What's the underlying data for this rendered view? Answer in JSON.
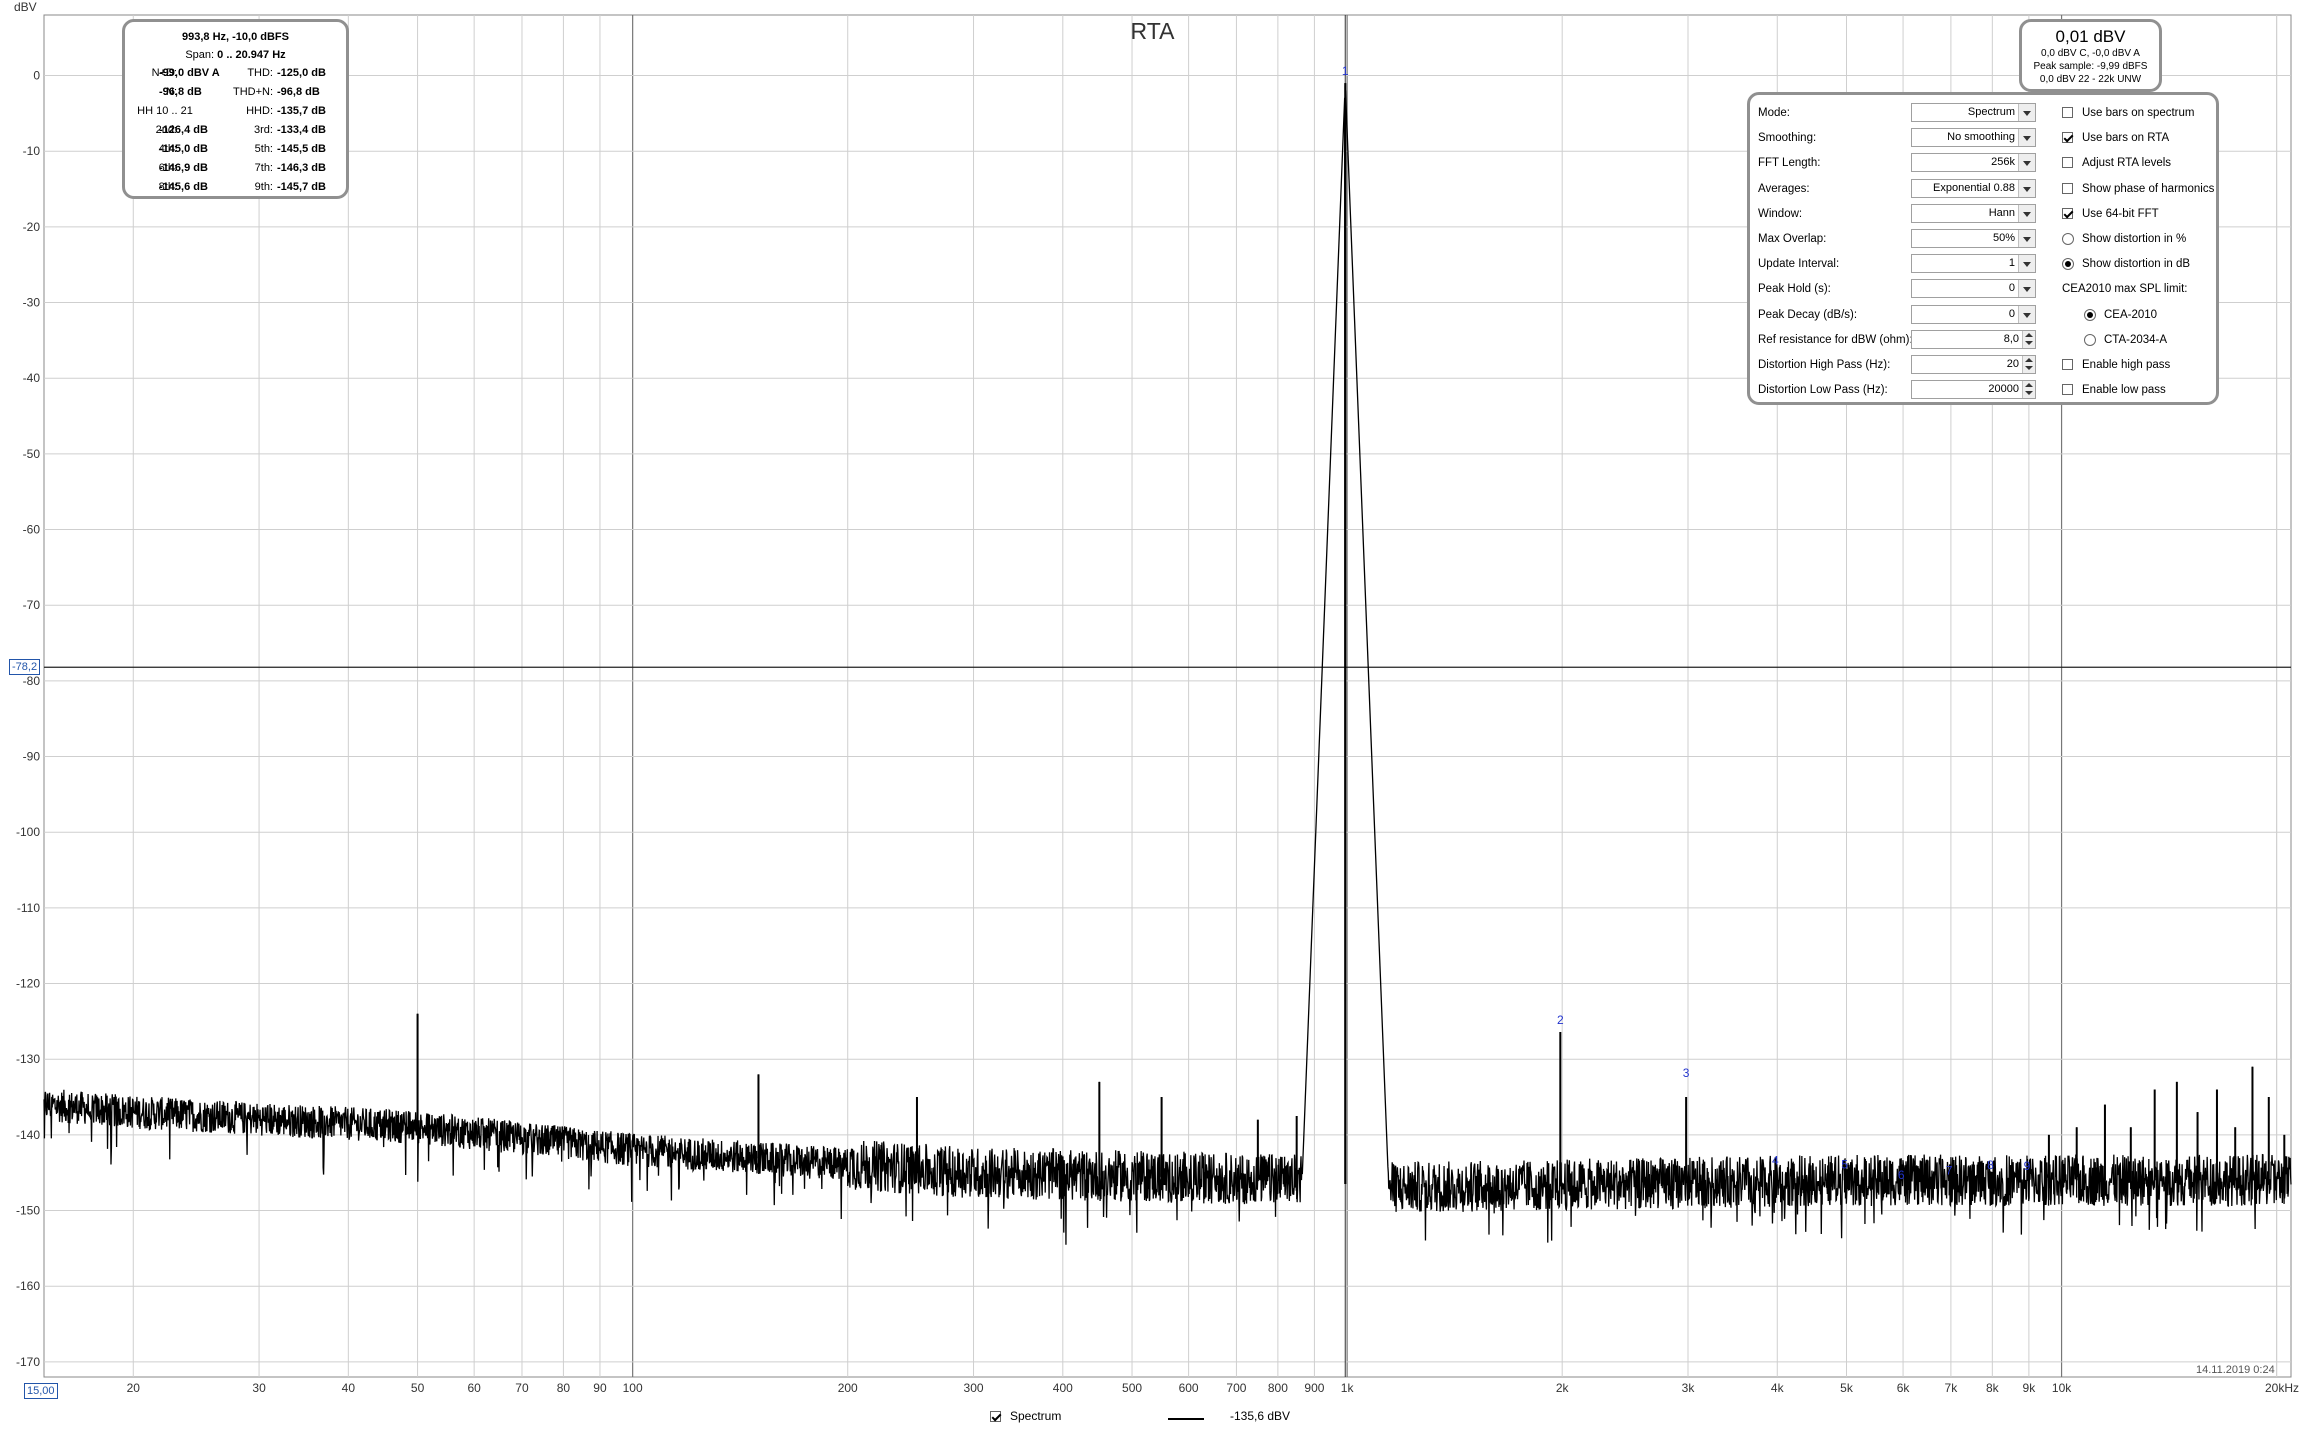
{
  "chart_data": {
    "type": "line",
    "title": "RTA",
    "xlabel": "",
    "ylabel": "dBV",
    "xscale": "log",
    "xlim": [
      15,
      20947
    ],
    "ylim": [
      -172,
      8
    ],
    "grid": true,
    "x_tick_labels": [
      "20",
      "30",
      "40",
      "50",
      "60",
      "70",
      "80",
      "90",
      "100",
      "200",
      "300",
      "400",
      "500",
      "600",
      "700",
      "800",
      "900",
      "1k",
      "2k",
      "3k",
      "4k",
      "5k",
      "6k",
      "7k",
      "8k",
      "9k",
      "10k",
      "20kHz"
    ],
    "x_tick_values": [
      20,
      30,
      40,
      50,
      60,
      70,
      80,
      90,
      100,
      200,
      300,
      400,
      500,
      600,
      700,
      800,
      900,
      1000,
      2000,
      3000,
      4000,
      5000,
      6000,
      7000,
      8000,
      9000,
      10000,
      20000
    ],
    "y_tick_values": [
      0,
      -10,
      -20,
      -30,
      -40,
      -50,
      -60,
      -70,
      -80,
      -90,
      -100,
      -110,
      -120,
      -130,
      -140,
      -150,
      -160,
      -170
    ],
    "series": [
      {
        "name": "Spectrum",
        "color": "#000000",
        "noise_floor": {
          "x": [
            15,
            20,
            50,
            100,
            300,
            900,
            1100,
            5000,
            10000,
            20947
          ],
          "y": [
            -136,
            -137,
            -139,
            -142,
            -145,
            -146,
            -147,
            -146,
            -146,
            -146
          ]
        },
        "peaks": [
          {
            "x": 50,
            "y": -124
          },
          {
            "x": 150,
            "y": -132
          },
          {
            "x": 250,
            "y": -135
          },
          {
            "x": 450,
            "y": -133
          },
          {
            "x": 550,
            "y": -135
          },
          {
            "x": 750,
            "y": -138
          },
          {
            "x": 850,
            "y": -137.5
          },
          {
            "x": 994,
            "y": -1
          },
          {
            "x": 1988,
            "y": -126.4
          },
          {
            "x": 2982,
            "y": -135
          },
          {
            "x": 3976,
            "y": -143
          },
          {
            "x": 4970,
            "y": -144
          },
          {
            "x": 5964,
            "y": -146
          },
          {
            "x": 6958,
            "y": -146
          },
          {
            "x": 7952,
            "y": -146
          },
          {
            "x": 8946,
            "y": -146
          },
          {
            "x": 9600,
            "y": -140
          },
          {
            "x": 10500,
            "y": -139
          },
          {
            "x": 11500,
            "y": -136
          },
          {
            "x": 12500,
            "y": -139
          },
          {
            "x": 13500,
            "y": -134
          },
          {
            "x": 14500,
            "y": -133
          },
          {
            "x": 15500,
            "y": -137
          },
          {
            "x": 16500,
            "y": -134
          },
          {
            "x": 17500,
            "y": -139
          },
          {
            "x": 18500,
            "y": -131
          },
          {
            "x": 19500,
            "y": -135
          },
          {
            "x": 20500,
            "y": -140
          }
        ]
      }
    ],
    "harmonic_markers": [
      {
        "label": "1",
        "x": 994,
        "y": -1
      },
      {
        "label": "2",
        "x": 1988,
        "y": -126.4
      },
      {
        "label": "3",
        "x": 2982,
        "y": -133.4
      },
      {
        "label": "4",
        "x": 3976,
        "y": -145.0
      },
      {
        "label": "5",
        "x": 4970,
        "y": -145.5
      },
      {
        "label": "6",
        "x": 5964,
        "y": -146.9
      },
      {
        "label": "7",
        "x": 6958,
        "y": -146.3
      },
      {
        "label": "8",
        "x": 7952,
        "y": -145.6
      },
      {
        "label": "9",
        "x": 8946,
        "y": -145.7
      }
    ],
    "cursor_y": -78.2,
    "cursor_label": "-78,2",
    "x_start_label": "15,00"
  },
  "y_unit": "dBV",
  "harmonics_panel": {
    "header": "993,8 Hz, -10,0 dBFS",
    "span_label": "Span:",
    "span_value": "0 .. 20.947 Hz",
    "rows": [
      {
        "l1": "N+D:",
        "v1": "-99,0 dBV A",
        "l2": "THD:",
        "v2": "-125,0 dB"
      },
      {
        "l1": "N:",
        "v1": "-96,8 dB",
        "l2": "THD+N:",
        "v2": "-96,8 dB"
      },
      {
        "l1": "HH 10 .. 21",
        "v1": "",
        "l2": "HHD:",
        "v2": "-135,7 dB"
      },
      {
        "l1": "2nd:",
        "v1": "-126,4 dB",
        "l2": "3rd:",
        "v2": "-133,4 dB"
      },
      {
        "l1": "4th:",
        "v1": "-145,0 dB",
        "l2": "5th:",
        "v2": "-145,5 dB"
      },
      {
        "l1": "6th:",
        "v1": "-146,9 dB",
        "l2": "7th:",
        "v2": "-146,3 dB"
      },
      {
        "l1": "8th:",
        "v1": "-145,6 dB",
        "l2": "9th:",
        "v2": "-145,7 dB"
      }
    ]
  },
  "level_panel": {
    "value": "0,01 dBV",
    "line1": "0,0 dBV C, -0,0 dBV A",
    "line2": "Peak sample: -9,99 dBFS",
    "line3": "0,0 dBV 22 - 22k UNW"
  },
  "settings": {
    "fields": [
      {
        "label": "Mode:",
        "value": "Spectrum",
        "control": "dropdown"
      },
      {
        "label": "Smoothing:",
        "value": "No  smoothing",
        "control": "dropdown"
      },
      {
        "label": "FFT Length:",
        "value": "256k",
        "control": "dropdown"
      },
      {
        "label": "Averages:",
        "value": "Exponential 0.88",
        "control": "dropdown"
      },
      {
        "label": "Window:",
        "value": "Hann",
        "control": "dropdown"
      },
      {
        "label": "Max Overlap:",
        "value": "50%",
        "control": "dropdown"
      },
      {
        "label": "Update Interval:",
        "value": "1",
        "control": "dropdown"
      },
      {
        "label": "Peak Hold (s):",
        "value": "0",
        "control": "dropdown"
      },
      {
        "label": "Peak Decay (dB/s):",
        "value": "0",
        "control": "dropdown"
      },
      {
        "label": "Ref resistance for dBW (ohm):",
        "value": "8,0",
        "control": "spinner"
      },
      {
        "label": "Distortion High Pass (Hz):",
        "value": "20",
        "control": "spinner"
      },
      {
        "label": "Distortion Low Pass (Hz):",
        "value": "20000",
        "control": "spinner"
      }
    ],
    "options": [
      {
        "label": "Use bars on spectrum",
        "kind": "checkbox",
        "checked": false
      },
      {
        "label": "Use bars on RTA",
        "kind": "checkbox",
        "checked": true
      },
      {
        "label": "Adjust RTA levels",
        "kind": "checkbox",
        "checked": false
      },
      {
        "label": "Show phase of harmonics",
        "kind": "checkbox",
        "checked": false
      },
      {
        "label": "Use 64-bit FFT",
        "kind": "checkbox",
        "checked": true
      },
      {
        "label": "Show distortion in %",
        "kind": "radio",
        "checked": false
      },
      {
        "label": "Show distortion in dB",
        "kind": "radio",
        "checked": true
      },
      {
        "label": "CEA2010 max SPL limit:",
        "kind": "label",
        "checked": false
      },
      {
        "label": "CEA-2010",
        "kind": "radio-indent",
        "checked": true
      },
      {
        "label": "CTA-2034-A",
        "kind": "radio-indent",
        "checked": false
      },
      {
        "label": "Enable high pass",
        "kind": "checkbox",
        "checked": false
      },
      {
        "label": "Enable low pass",
        "kind": "checkbox",
        "checked": false
      }
    ]
  },
  "legend": {
    "label": "Spectrum",
    "checked": true,
    "value": "-135,6 dBV"
  },
  "timestamp": "14.11.2019 0:24"
}
